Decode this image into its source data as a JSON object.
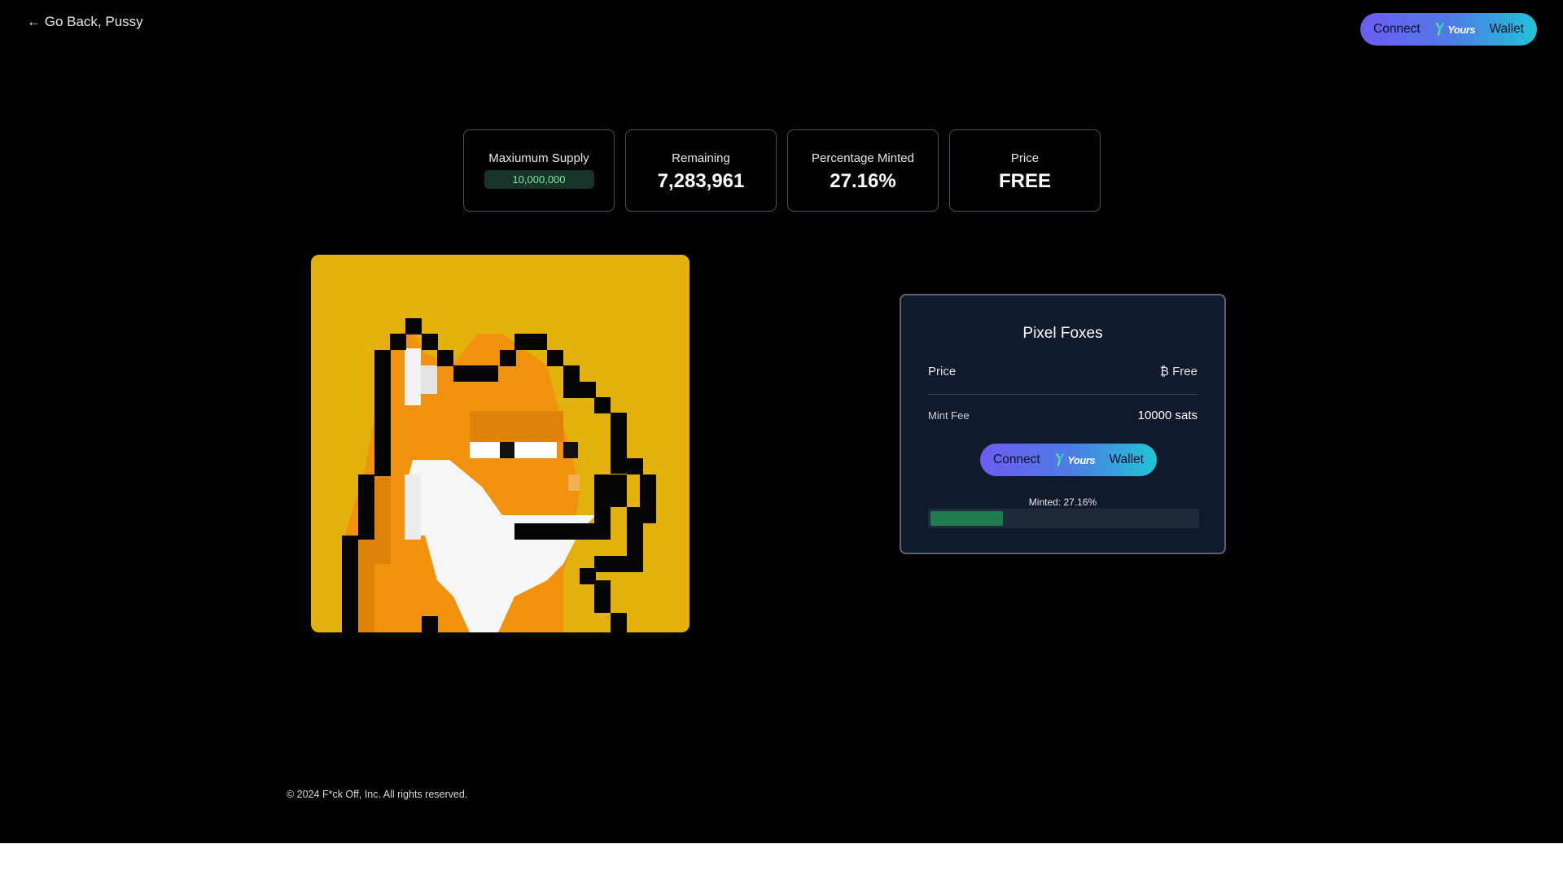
{
  "nav": {
    "back_label": "← Go Back, Pussy"
  },
  "wallet": {
    "connect_label": "Connect",
    "brand_label": "Yours",
    "wallet_label": "Wallet",
    "gradient_start": "#6d5cf2",
    "gradient_end": "#21c3d6"
  },
  "stats": [
    {
      "label": "Maxiumum Supply",
      "value": "10,000,000"
    },
    {
      "label": "Remaining",
      "value": "7,283,961"
    },
    {
      "label": "Percentage Minted",
      "value": "27.16%"
    },
    {
      "label": "Price",
      "value": "FREE"
    }
  ],
  "artwork": {
    "subject": "pixel-fox-icon",
    "background_color": "#e3b10b"
  },
  "mint_card": {
    "title": "Pixel Foxes",
    "price_label": "Price",
    "price_value": "₿ Free",
    "fee_label": "Mint Fee",
    "fee_value": "10000 sats",
    "minted_label": "Minted: 27.16%",
    "minted_fraction": 0.2716,
    "progress_color": "#1f7a4f"
  },
  "footer": {
    "copyright": "© 2024 F*ck Off, Inc. All rights reserved."
  }
}
